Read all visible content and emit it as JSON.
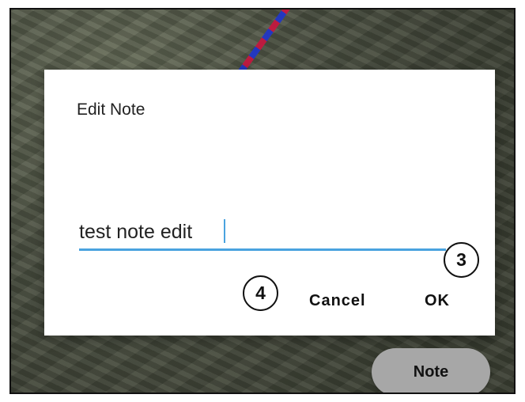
{
  "dialog": {
    "title": "Edit Note",
    "input_value": "test note edit",
    "cancel_label": "Cancel",
    "ok_label": "OK"
  },
  "callouts": {
    "ok_marker": "3",
    "cancel_marker": "4"
  },
  "map": {
    "note_button_label": "Note",
    "accent_color": "#4aa3df",
    "path_colors": [
      "#c2183f",
      "#2136c5"
    ]
  }
}
